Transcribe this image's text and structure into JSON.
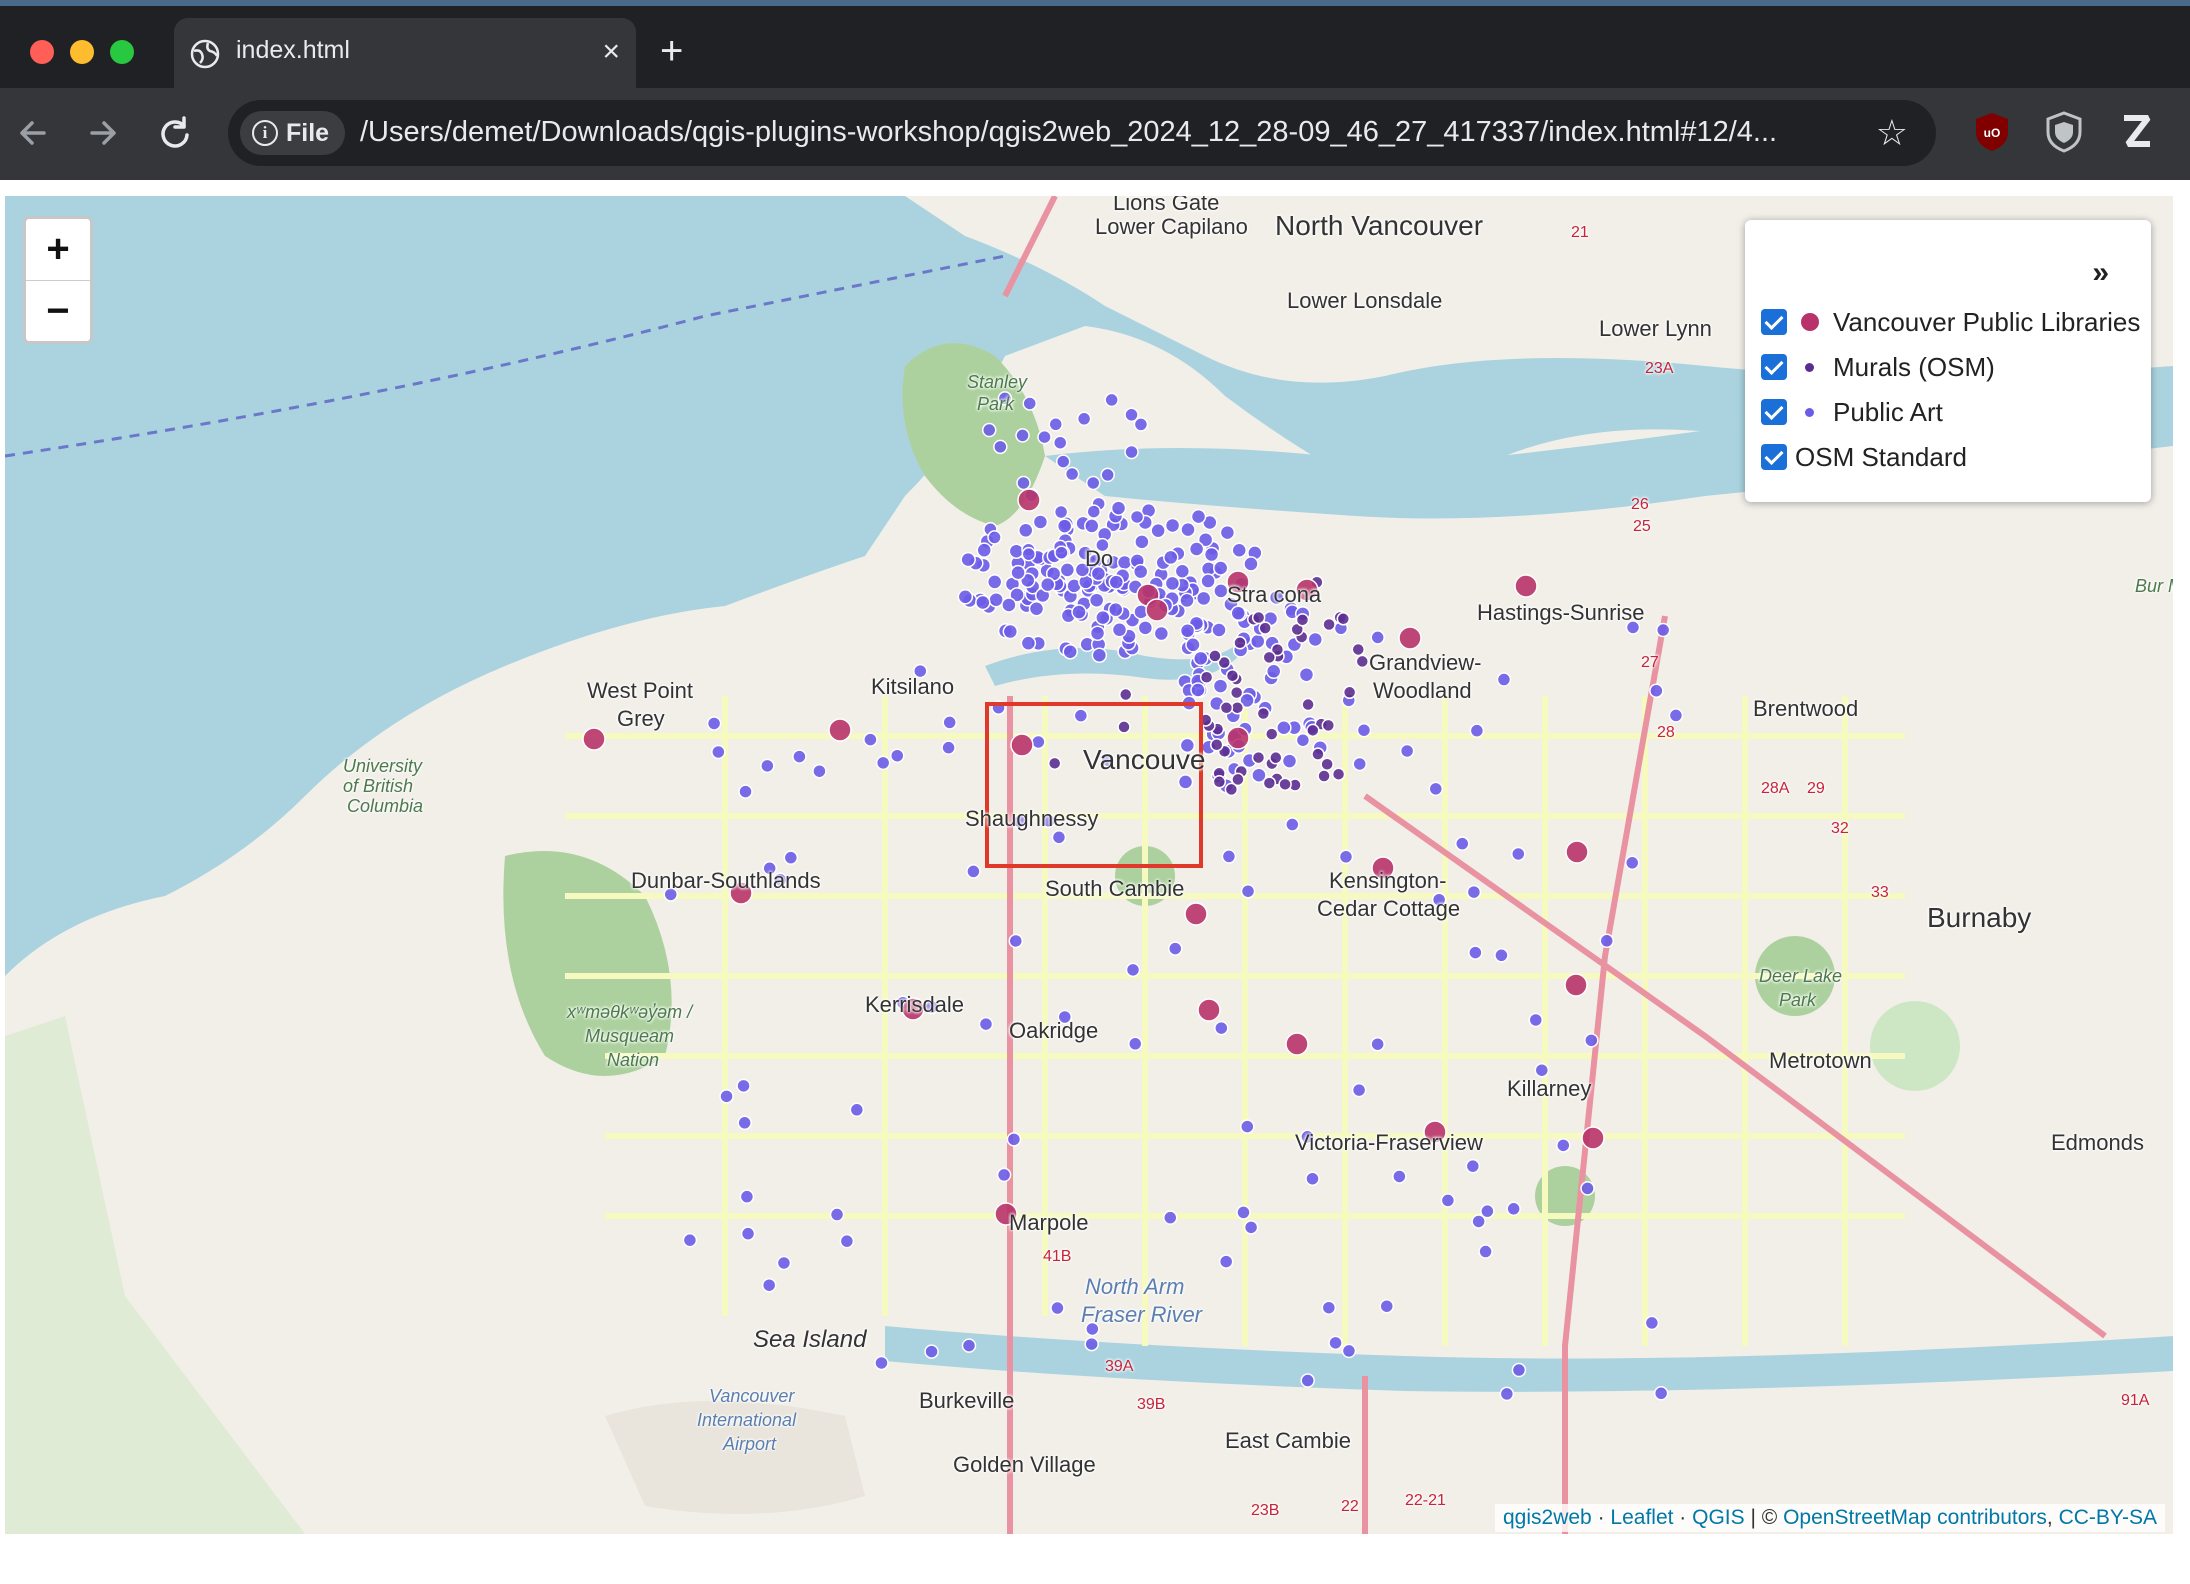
{
  "browser": {
    "tab_title": "index.html",
    "tab_close": "×",
    "new_tab": "+",
    "chip_label": "File",
    "url": "/Users/demet/Downloads/qgis-plugins-workshop/qgis2web_2024_12_28-09_46_27_417337/index.html#12/4...",
    "traffic_colors": [
      "#ff5f57",
      "#febc2e",
      "#28c840"
    ],
    "extensions": [
      "ublock-icon",
      "shield-extension-icon",
      "z-extension-icon"
    ]
  },
  "map": {
    "zoom_in": "+",
    "zoom_out": "−",
    "layer_toggle": "»",
    "layers": [
      {
        "label": "Vancouver Public Libraries",
        "checked": true,
        "color": "#b8336a"
      },
      {
        "label": "Murals (OSM)",
        "checked": true,
        "color": "#5c2d91"
      },
      {
        "label": "Public Art",
        "checked": true,
        "color": "#6b5ce7"
      },
      {
        "label": "OSM Standard",
        "checked": true
      }
    ],
    "places": {
      "north_vancouver": "North Vancouver",
      "lions_gate": "Lions Gate",
      "lower_capilano": "Lower Capilano",
      "lower_lonsdale": "Lower Lonsdale",
      "lower_lynn": "Lower Lynn",
      "stanley": "Stanley",
      "park": "Park",
      "downtown": "Do",
      "strathcona": "Stra   cona",
      "hastings_sunrise": "Hastings-Sunrise",
      "grandview": "Grandview-",
      "woodland": "Woodland",
      "kitsilano": "Kitsilano",
      "west_point": "West Point",
      "grey": "Grey",
      "ubc_1": "University",
      "ubc_2": "of British",
      "ubc_3": "Columbia",
      "vancouver": "Vancouve",
      "shaughnessy": "Shaughnessy",
      "brentwood": "Brentwood",
      "dunbar": "Dunbar-Southlands",
      "south_cambie": "South Cambie",
      "kensington_1": "Kensington-",
      "kensington_2": "Cedar Cottage",
      "burnaby": "Burnaby",
      "deer_lake_1": "Deer Lake",
      "deer_lake_2": "Park",
      "kerrisdale": "Kerrisdale",
      "oakridge": "Oakridge",
      "musqueam_1": "xʷməθkʷəy̓əm /",
      "musqueam_2": "Musqueam",
      "musqueam_3": "Nation",
      "metrotown": "Metrotown",
      "killarney": "Killarney",
      "victoria_fraserview": "Victoria-Fraserview",
      "edmonds": "Edmonds",
      "marpole": "Marpole",
      "north_arm_1": "North Arm",
      "north_arm_2": "Fraser River",
      "sea_island": "Sea Island",
      "yvr_1": "Vancouver",
      "yvr_2": "International",
      "yvr_3": "Airport",
      "burkeville": "Burkeville",
      "east_cambie": "East Cambie",
      "golden_village": "Golden Village",
      "burnaby_cons": "Bur Mou Conse",
      "hwy_21": "21",
      "hwy_23a": "23A",
      "hwy_26": "26",
      "hwy_25": "25",
      "hwy_27": "27",
      "hwy_28": "28",
      "hwy_28a": "28A",
      "hwy_29": "29",
      "hwy_32": "32",
      "hwy_33": "33",
      "hwy_41b": "41B",
      "hwy_39a": "39A",
      "hwy_39b": "39B",
      "hwy_91a": "91A",
      "hwy_23b": "23B",
      "hwy_22": "22",
      "hwy_22a": "22-21"
    },
    "attribution": {
      "qgis2web": "qgis2web",
      "sep1": " · ",
      "leaflet": "Leaflet",
      "sep2": " · ",
      "qgis": "QGIS",
      "sep3": " | © ",
      "osm": "OpenStreetMap contributors",
      "sep4": ", ",
      "license": "CC-BY-SA"
    }
  }
}
